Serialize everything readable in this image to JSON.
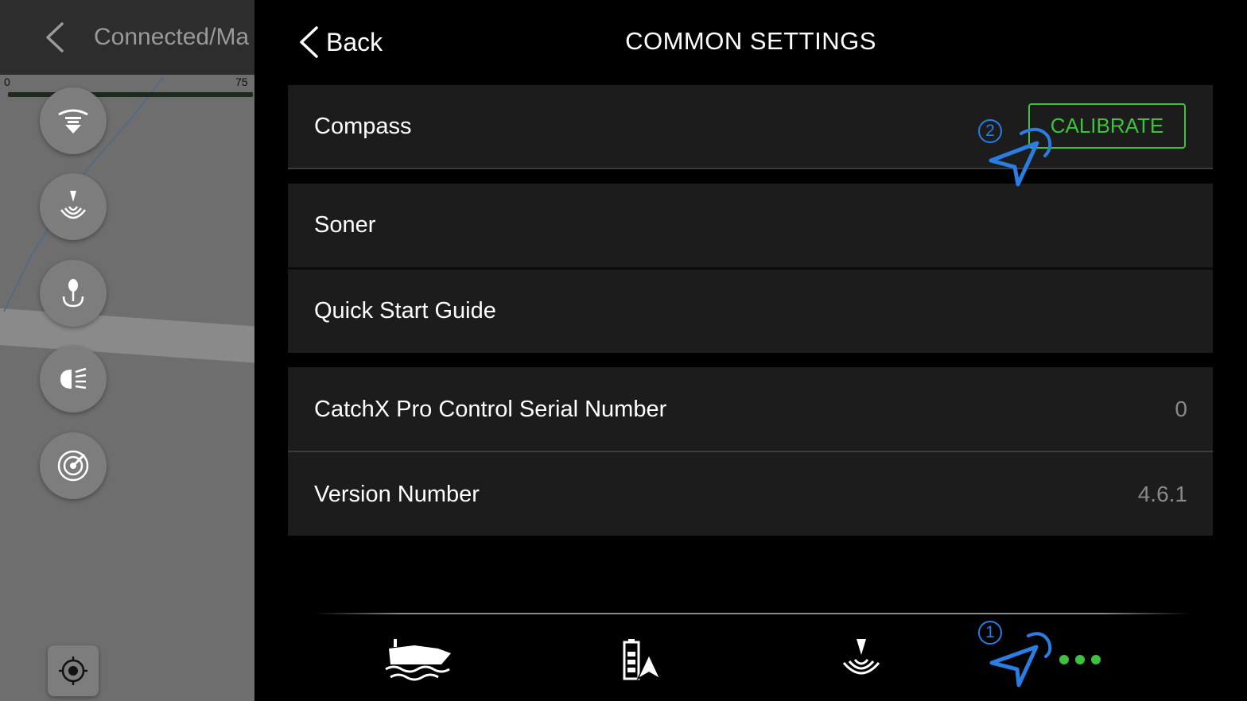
{
  "left_panel": {
    "title": "Connected/Ma",
    "scale": {
      "min": "0",
      "max": "75"
    },
    "buttons": [
      "drop-marker-icon",
      "sonar-icon",
      "bait-hook-icon",
      "headlight-icon",
      "radar-icon"
    ],
    "locate_icon": "locate-crosshair-icon"
  },
  "header": {
    "back_label": "Back",
    "title": "COMMON SETTINGS"
  },
  "settings": {
    "compass": {
      "label": "Compass",
      "action": "CALIBRATE"
    },
    "soner": {
      "label": "Soner"
    },
    "quick_start": {
      "label": "Quick Start Guide"
    },
    "serial": {
      "label": "CatchX Pro Control Serial Number",
      "value": "0"
    },
    "version": {
      "label": "Version Number",
      "value": "4.6.1"
    }
  },
  "bottom_nav": {
    "items": [
      "boat-icon",
      "battery-navigation-icon",
      "sonar-icon",
      "navigation-arrow-icon",
      "more-dots-icon"
    ]
  },
  "annotations": {
    "step1": "1",
    "step2": "2"
  },
  "colors": {
    "accent_green": "#3ec23e",
    "annotation_blue": "#2a7de1",
    "row_bg": "#1c1c1c"
  }
}
